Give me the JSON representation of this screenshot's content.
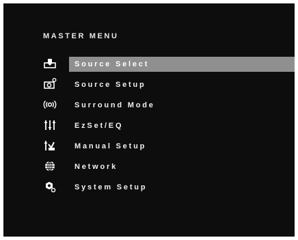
{
  "menu": {
    "title": "MASTER MENU",
    "selected_index": 0,
    "items": [
      {
        "label": "Source Select",
        "icon": "source-select-icon"
      },
      {
        "label": "Source Setup",
        "icon": "source-setup-icon"
      },
      {
        "label": "Surround Mode",
        "icon": "surround-mode-icon"
      },
      {
        "label": "EzSet/EQ",
        "icon": "eq-icon"
      },
      {
        "label": "Manual Setup",
        "icon": "manual-setup-icon"
      },
      {
        "label": "Network",
        "icon": "network-globe-icon"
      },
      {
        "label": "System Setup",
        "icon": "system-setup-icon"
      }
    ]
  },
  "colors": {
    "background": "#0d0d0d",
    "text": "#f0f0f0",
    "highlight": "#8f8f8f"
  }
}
